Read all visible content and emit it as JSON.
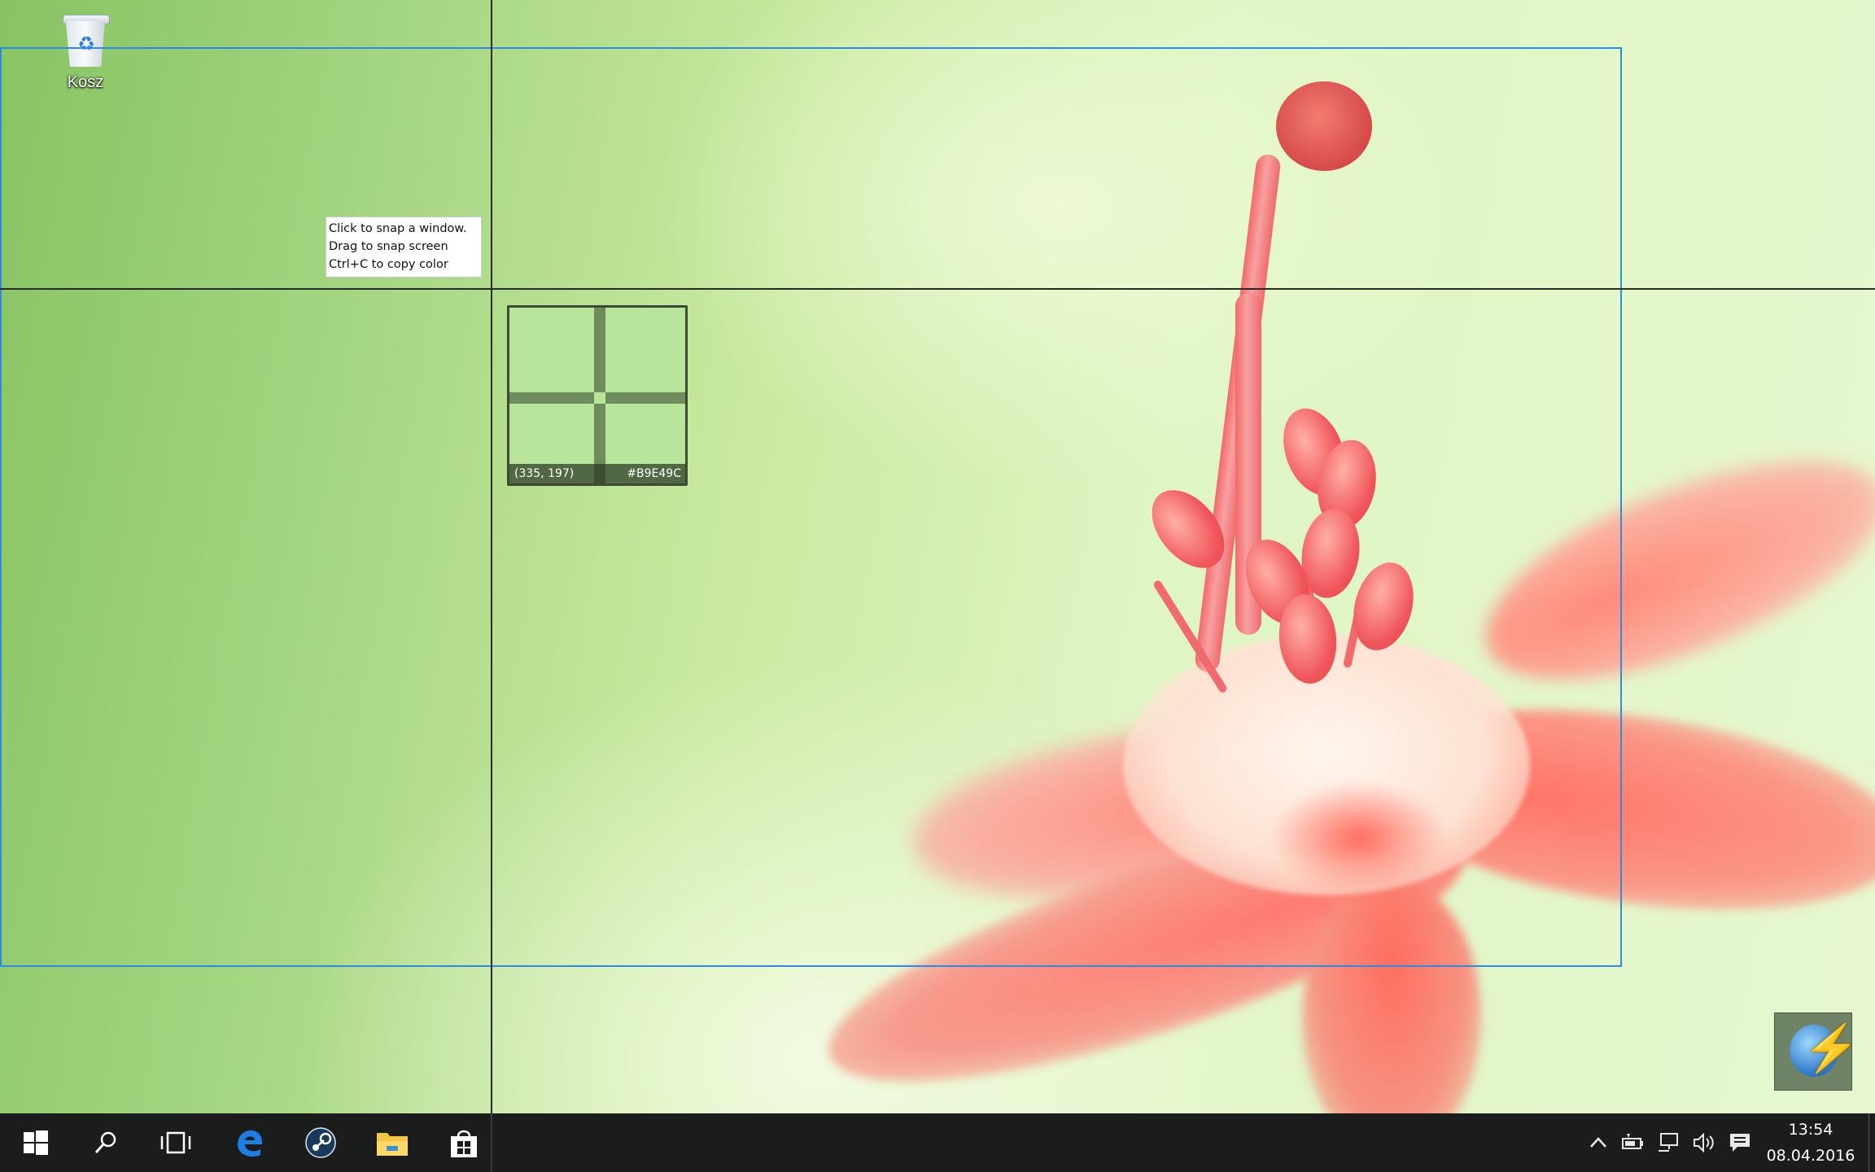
{
  "desktop": {
    "icons": [
      {
        "label": "Kosz",
        "icon": "recycle-bin-icon"
      }
    ]
  },
  "picker": {
    "tooltip_lines": [
      "Click to snap a window.",
      "Drag to snap screen",
      "Ctrl+C to copy color"
    ],
    "magnifier": {
      "coords": "(335, 197)",
      "hex": "#B9E49C"
    },
    "accent_color": "#2e8ae6",
    "sampled_color": "#B9E49C"
  },
  "floating_app": {
    "icon": "lightning-orb-icon"
  },
  "taskbar": {
    "pinned": [
      {
        "name": "start",
        "icon": "windows-logo-icon"
      },
      {
        "name": "search",
        "icon": "search-icon"
      },
      {
        "name": "task-view",
        "icon": "task-view-icon"
      },
      {
        "name": "edge",
        "icon": "edge-icon"
      },
      {
        "name": "steam",
        "icon": "steam-icon"
      },
      {
        "name": "file-explorer",
        "icon": "folder-icon"
      },
      {
        "name": "store",
        "icon": "store-icon"
      }
    ],
    "tray": {
      "icons": [
        "chevron-up-icon",
        "battery-icon",
        "network-icon",
        "volume-icon",
        "action-center-icon"
      ],
      "time": "13:54",
      "date": "08.04.2016"
    }
  }
}
